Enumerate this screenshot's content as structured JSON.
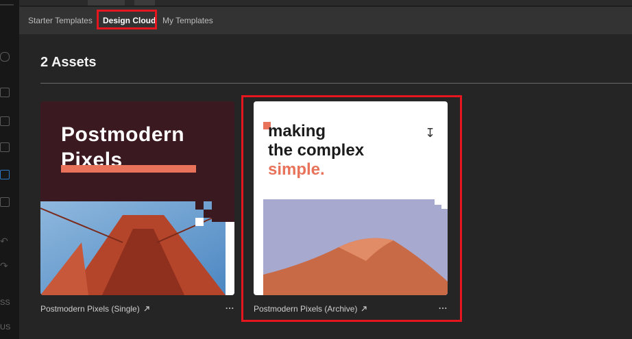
{
  "tabs": [
    {
      "label": "Starter Templates"
    },
    {
      "label": "Design Cloud",
      "active": true
    },
    {
      "label": "My Templates"
    }
  ],
  "assets_title": "2 Assets",
  "cards": [
    {
      "label": "Postmodern Pixels (Single)",
      "more": "...",
      "thumb": {
        "headline_1": "Postmodern",
        "headline_2": "Pixels"
      }
    },
    {
      "label": "Postmodern Pixels (Archive)",
      "more": "...",
      "thumb": {
        "headline_1": "making",
        "headline_2": "the complex",
        "headline_3": "simple."
      }
    }
  ],
  "left_strip": {
    "text_1": "SS",
    "text_2": "US"
  },
  "colors": {
    "highlight": "#e5161d",
    "accent": "#e8735a",
    "thumb1_bg": "#3a1a20"
  }
}
